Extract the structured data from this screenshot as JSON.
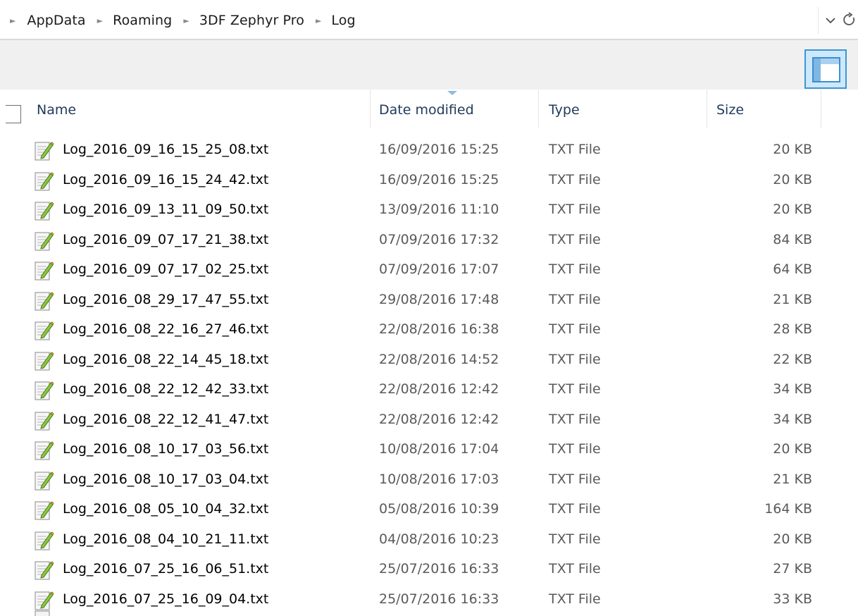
{
  "breadcrumb": {
    "items": [
      "AppData",
      "Roaming",
      "3DF Zephyr Pro",
      "Log"
    ]
  },
  "address_bar": {
    "dropdown_icon": "chevron-down-icon",
    "refresh_icon": "refresh-icon"
  },
  "toolbar": {
    "preview_pane_icon": "preview-pane-icon"
  },
  "columns": {
    "name": "Name",
    "date_modified": "Date modified",
    "type": "Type",
    "size": "Size",
    "sorted_by": "Date modified"
  },
  "files": [
    {
      "name": "Log_2016_09_16_15_25_08.txt",
      "date": "16/09/2016 15:25",
      "type": "TXT File",
      "size": "20 KB"
    },
    {
      "name": "Log_2016_09_16_15_24_42.txt",
      "date": "16/09/2016 15:25",
      "type": "TXT File",
      "size": "20 KB"
    },
    {
      "name": "Log_2016_09_13_11_09_50.txt",
      "date": "13/09/2016 11:10",
      "type": "TXT File",
      "size": "20 KB"
    },
    {
      "name": "Log_2016_09_07_17_21_38.txt",
      "date": "07/09/2016 17:32",
      "type": "TXT File",
      "size": "84 KB"
    },
    {
      "name": "Log_2016_09_07_17_02_25.txt",
      "date": "07/09/2016 17:07",
      "type": "TXT File",
      "size": "64 KB"
    },
    {
      "name": "Log_2016_08_29_17_47_55.txt",
      "date": "29/08/2016 17:48",
      "type": "TXT File",
      "size": "21 KB"
    },
    {
      "name": "Log_2016_08_22_16_27_46.txt",
      "date": "22/08/2016 16:38",
      "type": "TXT File",
      "size": "28 KB"
    },
    {
      "name": "Log_2016_08_22_14_45_18.txt",
      "date": "22/08/2016 14:52",
      "type": "TXT File",
      "size": "22 KB"
    },
    {
      "name": "Log_2016_08_22_12_42_33.txt",
      "date": "22/08/2016 12:42",
      "type": "TXT File",
      "size": "34 KB"
    },
    {
      "name": "Log_2016_08_22_12_41_47.txt",
      "date": "22/08/2016 12:42",
      "type": "TXT File",
      "size": "34 KB"
    },
    {
      "name": "Log_2016_08_10_17_03_56.txt",
      "date": "10/08/2016 17:04",
      "type": "TXT File",
      "size": "20 KB"
    },
    {
      "name": "Log_2016_08_10_17_03_04.txt",
      "date": "10/08/2016 17:03",
      "type": "TXT File",
      "size": "21 KB"
    },
    {
      "name": "Log_2016_08_05_10_04_32.txt",
      "date": "05/08/2016 10:39",
      "type": "TXT File",
      "size": "164 KB"
    },
    {
      "name": "Log_2016_08_04_10_21_11.txt",
      "date": "04/08/2016 10:23",
      "type": "TXT File",
      "size": "20 KB"
    },
    {
      "name": "Log_2016_07_25_16_06_51.txt",
      "date": "25/07/2016 16:33",
      "type": "TXT File",
      "size": "27 KB"
    },
    {
      "name": "Log_2016_07_25_16_09_04.txt",
      "date": "25/07/2016 16:33",
      "type": "TXT File",
      "size": "33 KB"
    }
  ],
  "icons": {
    "file": "text-file-icon"
  }
}
